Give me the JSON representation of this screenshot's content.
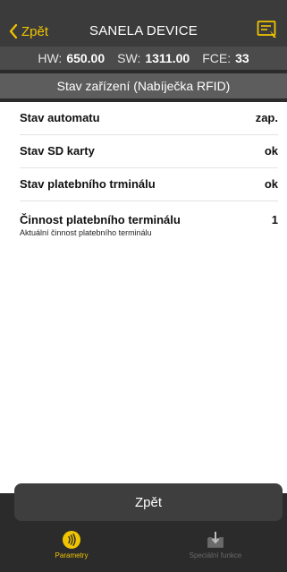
{
  "nav": {
    "back_label": "Zpět",
    "title": "SANELA DEVICE"
  },
  "info_bar": {
    "hw_label": "HW:",
    "hw_value": "650.00",
    "sw_label": "SW:",
    "sw_value": "1311.00",
    "fce_label": "FCE:",
    "fce_value": "33"
  },
  "section": {
    "title": "Stav zařízení (Nabíječka RFID)"
  },
  "rows": [
    {
      "label": "Stav automatu",
      "value": "zap."
    },
    {
      "label": "Stav SD karty",
      "value": "ok"
    },
    {
      "label": "Stav platebního trminálu",
      "value": "ok"
    },
    {
      "label": "Činnost platebního terminálu",
      "value": "1",
      "sub": "Aktuální činnost platebního terminálu"
    }
  ],
  "bottom_button": {
    "label": "Zpět"
  },
  "tabs": [
    {
      "label": "Parametry",
      "icon": "nfc-icon",
      "active": true
    },
    {
      "label": "Speciální funkce",
      "icon": "download-icon",
      "active": false
    }
  ],
  "colors": {
    "accent": "#f1c400",
    "background": "#2b2b2b",
    "content": "#ffffff"
  }
}
